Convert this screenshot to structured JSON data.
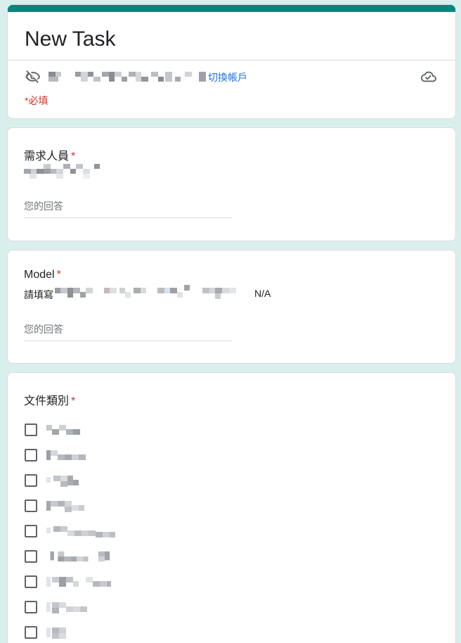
{
  "form": {
    "title": "New Task",
    "switch_account": "切換帳戶",
    "required_note": "*必填"
  },
  "questions": [
    {
      "title": "需求人員",
      "required_mark": "*",
      "placeholder": "您的回答"
    },
    {
      "title": "Model",
      "required_mark": "*",
      "description_prefix": "請填寫",
      "description_suffix": "N/A",
      "placeholder": "您的回答"
    },
    {
      "title": "文件類別",
      "required_mark": "*",
      "option_count_visible": 9
    }
  ],
  "colors": {
    "accent": "#00897b",
    "link": "#1a73e8",
    "required": "#d93025",
    "background": "#d9efec"
  },
  "icons": [
    "eye-off-icon",
    "cloud-check-icon"
  ]
}
